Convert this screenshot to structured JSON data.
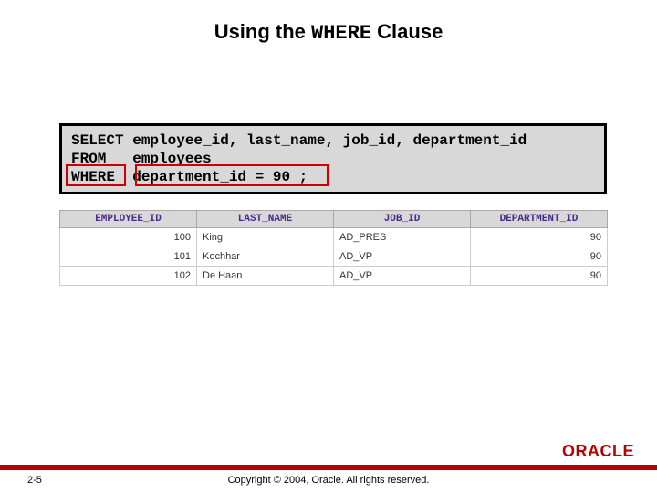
{
  "title": {
    "part1": "Using the ",
    "code": "WHERE",
    "part2": " Clause"
  },
  "sql": {
    "line1": "SELECT employee_id, last_name, job_id, department_id",
    "line2": "FROM   employees",
    "line3": "WHERE  department_id = 90 ;"
  },
  "table": {
    "headers": [
      "EMPLOYEE_ID",
      "LAST_NAME",
      "JOB_ID",
      "DEPARTMENT_ID"
    ],
    "rows": [
      {
        "employee_id": "100",
        "last_name": "King",
        "job_id": "AD_PRES",
        "department_id": "90"
      },
      {
        "employee_id": "101",
        "last_name": "Kochhar",
        "job_id": "AD_VP",
        "department_id": "90"
      },
      {
        "employee_id": "102",
        "last_name": "De Haan",
        "job_id": "AD_VP",
        "department_id": "90"
      }
    ]
  },
  "footer": {
    "page": "2-5",
    "copyright": "Copyright © 2004, Oracle. All rights reserved.",
    "logo": "ORACLE"
  }
}
